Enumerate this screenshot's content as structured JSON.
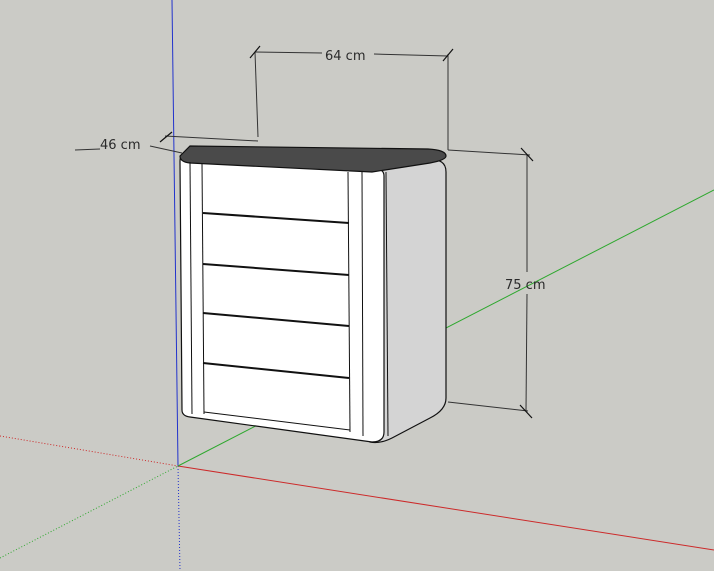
{
  "viewport": {
    "background_color": "#cbcbc6",
    "axis_colors": {
      "red": "#cc2a2a",
      "green": "#2ea82e",
      "blue": "#2233cc"
    }
  },
  "model": {
    "face_color": "#ffffff",
    "side_color": "#d4d4d4",
    "top_color": "#4a4a4a",
    "edge_color": "#111111"
  },
  "dimensions": {
    "width_label": "64 cm",
    "depth_label": "46 cm",
    "height_label": "75 cm"
  }
}
